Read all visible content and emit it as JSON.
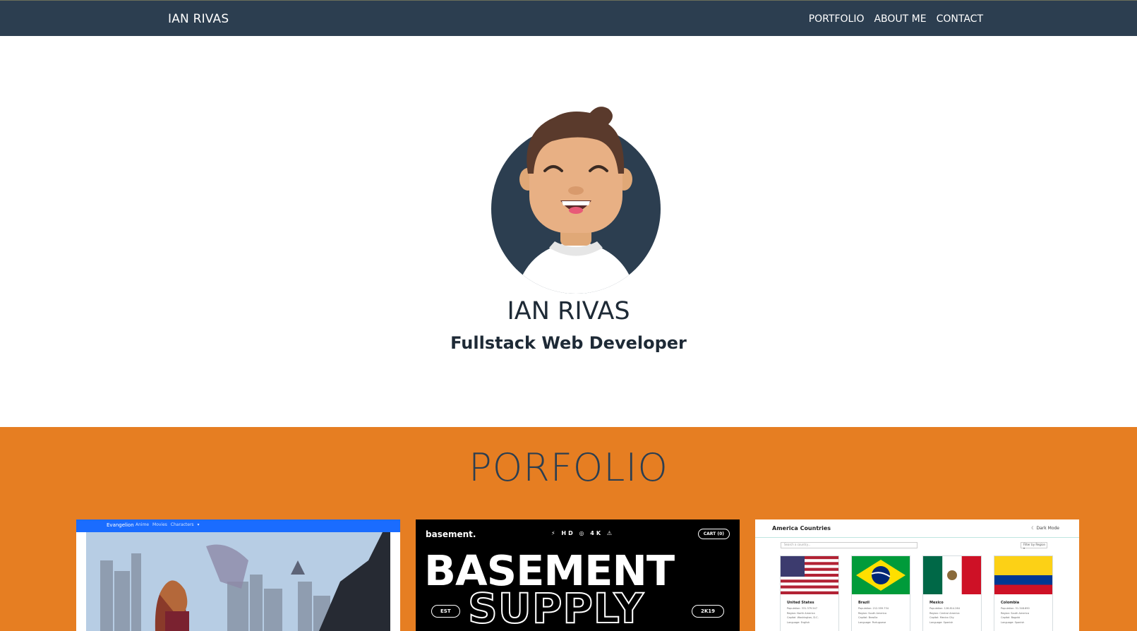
{
  "navbar": {
    "brand": "IAN RIVAS",
    "links": [
      "PORTFOLIO",
      "ABOUT ME",
      "CONTACT"
    ]
  },
  "hero": {
    "name": "IAN RIVAS",
    "subtitle": "Fullstack Web Developer",
    "avatar_icon": "avatar-illustration"
  },
  "portfolio": {
    "title": "PORFOLIO",
    "cards": [
      {
        "project": "evangelion",
        "brand": "Evangelion",
        "links": "Anime Movies Characters ▾"
      },
      {
        "project": "basement",
        "logo": "basement.",
        "cart": "CART (0)",
        "title": "BASEMENT",
        "subtitle": "SUPPLY",
        "pill_left": "EST",
        "pill_right": "2K19"
      },
      {
        "project": "america-countries",
        "title": "America Countries",
        "dark_mode": "☾ Dark Mode",
        "search_placeholder": "Search a country...",
        "filter": "Filter by Region ▾",
        "countries": [
          {
            "name": "United States",
            "meta": [
              "Population: 331.379.547",
              "Region: North America",
              "Capital: Washington, D.C.",
              "Language: English"
            ]
          },
          {
            "name": "Brazil",
            "meta": [
              "Population: 212.559.734",
              "Region: South America",
              "Capital: Brasília",
              "Language: Portuguese"
            ]
          },
          {
            "name": "Mexico",
            "meta": [
              "Population: 128.814.264",
              "Region: Central America",
              "Capital: Mexico City",
              "Language: Spanish"
            ]
          },
          {
            "name": "Colombia",
            "meta": [
              "Population: 51.348.690",
              "Region: South America",
              "Capital: Bogotá",
              "Language: Spanish"
            ]
          }
        ]
      }
    ]
  },
  "colors": {
    "navbar": "#2c3e50",
    "portfolio_bg": "#e67e22",
    "text_dark": "#2c3e50"
  }
}
